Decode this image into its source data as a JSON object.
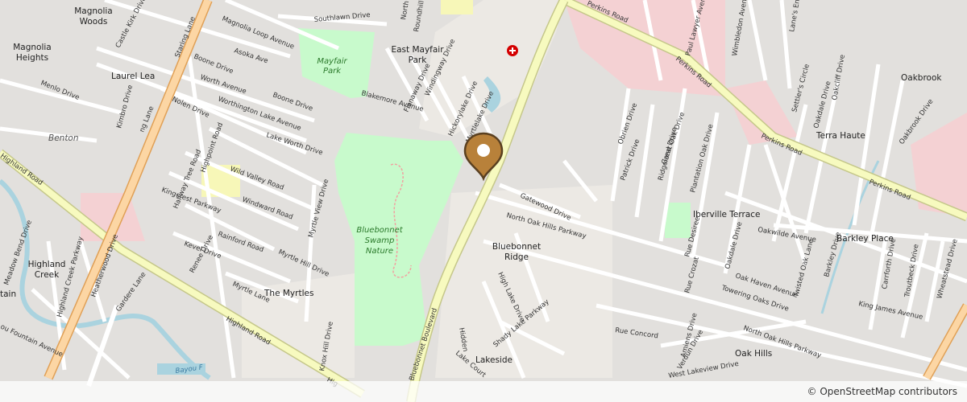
{
  "colors": {
    "land": "#f2efe9",
    "residential": "#e0dfdf",
    "park": "#c8facc",
    "major_road": "#fcd6a4",
    "major_casing": "#e0a056",
    "secondary_road": "#f7fabf",
    "secondary_casing": "#c5c78a",
    "water": "#aad3df",
    "hospital": "#f4d1d3",
    "marker": "#b8813a"
  },
  "places": {
    "magnolia_woods": "Magnolia\nWoods",
    "magnolia_heights": "Magnolia\nHeights",
    "laurel_lea": "Laurel Lea",
    "benton": "Benton",
    "east_mayfair_park": "East Mayfair\nPark",
    "terra_haute": "Terra Haute",
    "oakbrook": "Oakbrook",
    "iberville_terrace": "Iberville Terrace",
    "barkley_place": "Barkley Place",
    "bluebonnet_ridge": "Bluebonnet\nRidge",
    "highland_creek": "Highland\nCreek",
    "the_myrtles": "The Myrtles",
    "oak_hills": "Oak Hills",
    "lakeside": "Lakeside",
    "tain": "tain"
  },
  "parks": {
    "mayfair_park": "Mayfair\nPark",
    "bluebonnet_swamp": "Bluebonnet\nSwamp\nNature"
  },
  "streets": {
    "staring_lane": "Staring Lane",
    "staring_lane_2": "ng Lane",
    "perkins_road_1": "Perkins Road",
    "perkins_road_2": "Perkins Road",
    "perkins_road_3": "Perkins Road",
    "bluebonnet_boulevard": "Bluebonnet Boulevard",
    "highland_road": "Highland Road",
    "highland_road_2": "Hig",
    "magnolia_loop": "Magnolia Loop Avenue",
    "southlawn": "Southlawn Drive",
    "asoka": "Asoka Ave",
    "boone_drive": "Boone Drive",
    "boone_drive_2": "Boone Drive",
    "worth_avenue": "Worth Avenue",
    "worthington": "Worthington Lake Avenue",
    "nolen": "Nolen Drive",
    "menlo": "Menlo Drive",
    "kimbro": "Kimbro Drive",
    "castle_kirk": "Castle Kirk Drive",
    "blakemore": "Blakemore Avenue",
    "flanaway": "Flanaway Drive",
    "windingway": "Windingway Drive",
    "roundhill": "Roundhill",
    "north_sa": "North Sa",
    "hickorylake": "Hickorylake Drive",
    "myrtlelake": "Myrtlelake Drive",
    "lake_worth": "Lake Worth Drive",
    "highpoint": "Highpoint Road",
    "halfway_tree": "Halfway Tree Road",
    "wild_valley": "Wild Valley Road",
    "kingcrest": "Kingcrest Parkway",
    "windward": "Windward Road",
    "rainford": "Rainford Road",
    "kevel": "Kevel Drive",
    "renee": "Renee Drive",
    "myrtle_view": "Myrtle View Drive",
    "myrtle_hill": "Myrtle Hill Drive",
    "myrtle_lane": "Myrtle Lane",
    "knox_hill": "Knox Hill Drive",
    "gardere": "Gardere Lane",
    "heatherwood": "Heatherwood Drive",
    "highland_creek_pkwy": "Highland Creek Parkway",
    "meadow_bend": "Meadow Bend Drive",
    "fountain": "ou Fountain Avenue",
    "bayou": "Bayou F",
    "gatewood": "Gatewood Drive",
    "north_oak_hills": "North Oak Hills Parkway",
    "north_oak_hills_2": "North Oak Hills Parkway",
    "high_lake": "High Lake Drive",
    "shady_lake": "Shady Lake Parkway",
    "hidden": "Hidden",
    "lake_court": "Lake Court",
    "rue_concord": "Rue Concord",
    "obrien": "Obrien Drive",
    "patrick": "Patrick Drive",
    "great_oak": "Great Oak Drive",
    "ridgeland": "Ridgeland Drive",
    "plantation_oak": "Plantation Oak Drive",
    "rue_desiree": "Rue Desiree",
    "rue_crozat": "Rue Crozat",
    "oakdale": "Oakdale Drive",
    "oakwilde": "Oakwilde Avenue",
    "oak_haven": "Oak Haven Avenue",
    "twisted_oak": "Twisted Oak Lane",
    "towering_oaks": "Towering Oaks Drive",
    "king_james": "King James Avenue",
    "amiens": "Amiens Drive",
    "verdun": "Verdun Drive",
    "west_lakeview": "West Lakeview Drive",
    "paul_lawyer": "Paul Lawyer Avenue",
    "wimbledon": "Wimbledon Avenue",
    "lanes_end": "Lane's End",
    "settlers_circle": "Settler's Circle",
    "oakdale_drive_2": "Oakdale Drive",
    "oakcliff": "Oakcliff Drive",
    "oakbrook_drive": "Oakbrook Drive",
    "barkley_drive": "Barkley Drive",
    "carrforth": "Carrforth Drive",
    "troutbeck": "Troutbeck Drive",
    "wheatstead": "Wheatstead Drive"
  },
  "attribution": "© OpenStreetMap contributors",
  "marker": {
    "name": "location-pin"
  }
}
